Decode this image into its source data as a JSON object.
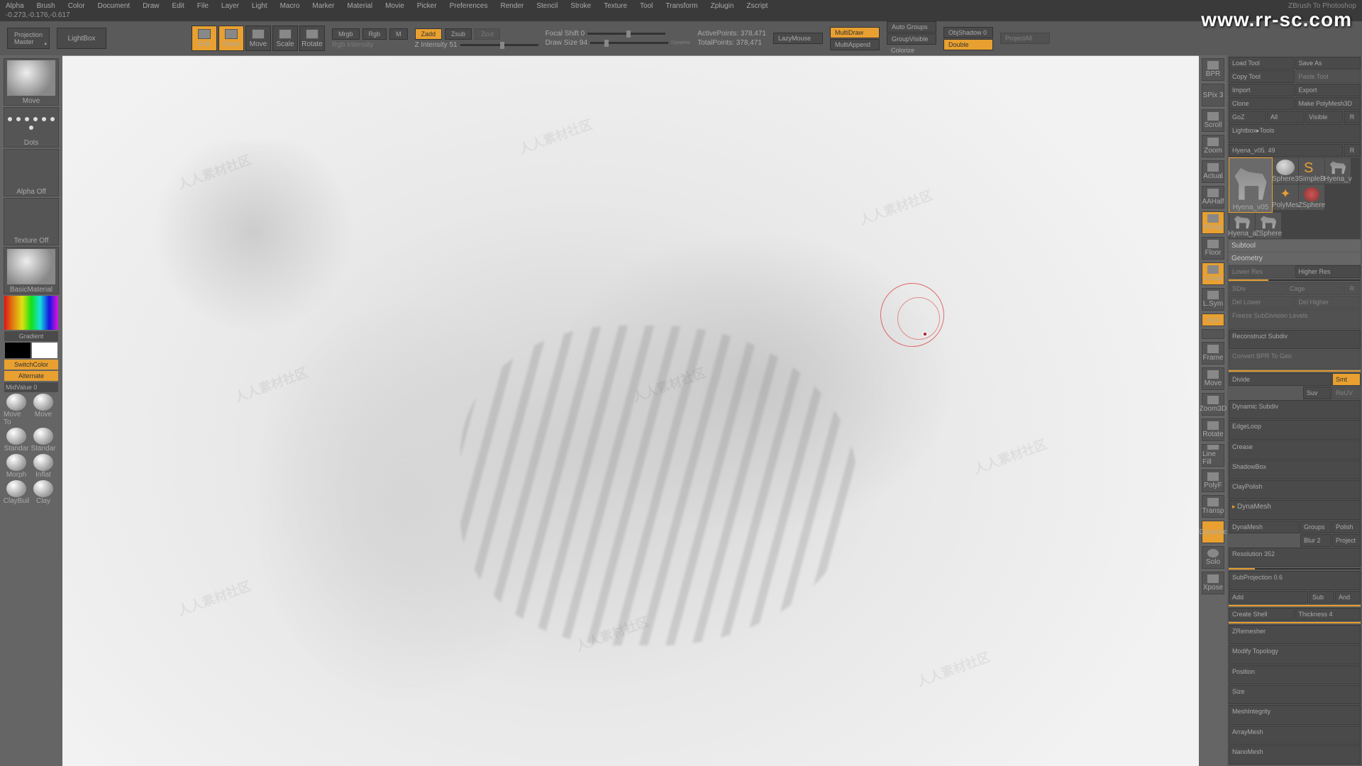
{
  "menubar": [
    "Alpha",
    "Brush",
    "Color",
    "Document",
    "Draw",
    "Edit",
    "File",
    "Layer",
    "Light",
    "Macro",
    "Marker",
    "Material",
    "Movie",
    "Picker",
    "Preferences",
    "Render",
    "Stencil",
    "Stroke",
    "Texture",
    "Tool",
    "Transform",
    "Zplugin",
    "Zscript"
  ],
  "app_title": "ZBrush To Photoshop",
  "coords": "-0.273,-0.176,-0.617",
  "url_watermark": "www.rr-sc.com",
  "toolbar": {
    "projection": "Projection\nMaster",
    "lightbox": "LightBox",
    "tools": [
      {
        "label": "Edit",
        "active": true
      },
      {
        "label": "Draw",
        "active": true
      },
      {
        "label": "Move",
        "active": false
      },
      {
        "label": "Scale",
        "active": false
      },
      {
        "label": "Rotate",
        "active": false
      }
    ],
    "rgb_intensity_label": "Rgb Intensity",
    "modes1": [
      "Mrgb",
      "Rgb",
      "M"
    ],
    "modes2": [
      {
        "l": "Zadd",
        "a": true
      },
      {
        "l": "Zsub",
        "a": false
      },
      {
        "l": "Zcut",
        "a": false
      }
    ],
    "z_intensity": "Z Intensity 51",
    "focal": "Focal Shift 0",
    "drawsize": "Draw Size 94",
    "dynamic": "Dynamic",
    "active_pts": "ActivePoints: 378,471",
    "total_pts": "TotalPoints: 378,471",
    "lazy": "LazyMouse",
    "col1": [
      {
        "l": "MultiDraw",
        "a": true
      },
      {
        "l": "MultiAppend",
        "a": false
      }
    ],
    "col2": [
      {
        "l": "Auto Groups",
        "a": false
      },
      {
        "l": "GroupVisible",
        "a": false
      },
      {
        "l": "Colorize",
        "a": false
      }
    ],
    "col3": [
      {
        "l": "ObjShadow 0",
        "a": false
      },
      {
        "l": "Double",
        "a": true
      },
      {
        "l": "",
        "a": false
      }
    ],
    "projectall": "ProjectAll"
  },
  "left": {
    "move": "Move",
    "dots": "Dots",
    "alpha_off": "Alpha Off",
    "texture_off": "Texture Off",
    "basic_mat": "BasicMaterial",
    "gradient": "Gradient",
    "switch": "SwitchColor",
    "alternate": "Alternate",
    "midvalue": "MidValue 0",
    "brushes": [
      "Move To",
      "Move",
      "Standar",
      "Standar",
      "Morph",
      "Inflat",
      "ClayBuil",
      "Clay"
    ]
  },
  "side_icons": [
    {
      "l": "BPR",
      "hl": false
    },
    {
      "l": "SPix 3",
      "hl": false
    },
    {
      "l": "Scroll",
      "hl": false
    },
    {
      "l": "Zoom",
      "hl": false
    },
    {
      "l": "Actual",
      "hl": false
    },
    {
      "l": "AAHalf",
      "hl": false
    },
    {
      "l": "Persp",
      "hl": true
    },
    {
      "l": "Floor",
      "hl": false
    },
    {
      "l": "Local",
      "hl": true
    },
    {
      "l": "L.Sym",
      "hl": false
    },
    {
      "l": "Xyz",
      "hl": true
    },
    {
      "l": "",
      "hl": false
    },
    {
      "l": "Frame",
      "hl": false
    },
    {
      "l": "Move",
      "hl": false
    },
    {
      "l": "Zoom3D",
      "hl": false
    },
    {
      "l": "Rotate",
      "hl": false
    },
    {
      "l": "Line Fill",
      "hl": false
    },
    {
      "l": "PolyF",
      "hl": false
    },
    {
      "l": "Transp",
      "hl": false
    },
    {
      "l": "Dynamic",
      "hl": true
    },
    {
      "l": "Solo",
      "hl": false
    },
    {
      "l": "Xpose",
      "hl": false
    }
  ],
  "right": {
    "row1": [
      "Load Tool",
      "Save As"
    ],
    "row2": [
      {
        "l": "Copy Tool"
      },
      {
        "l": "Paste Tool",
        "dim": true
      }
    ],
    "row3": [
      "Import",
      "Export"
    ],
    "row4": [
      "Clone",
      "Make PolyMesh3D"
    ],
    "row5": [
      {
        "l": "GoZ"
      },
      {
        "l": "All"
      },
      {
        "l": "Visible"
      },
      {
        "l": "R",
        "sm": true
      }
    ],
    "lightbox": "Lightbox▸Tools",
    "tool_name": "Hyena_v05. 49",
    "thumbs": [
      {
        "l": "Hyena_v05",
        "sel": true,
        "type": "animal"
      },
      {
        "l": "Sphere3",
        "type": "sphere"
      },
      {
        "l": "SimpleB",
        "type": "star"
      },
      {
        "l": "Hyena_v",
        "type": "animal"
      },
      {
        "l": "PolyMes",
        "type": "star2"
      },
      {
        "l": "ZSphere",
        "type": "sphere2"
      },
      {
        "l": "Hyena_a",
        "type": "animal"
      },
      {
        "l": "ZSphere",
        "type": "animal"
      }
    ],
    "subtool": "Subtool",
    "geometry": "Geometry",
    "geo_rows": [
      [
        {
          "l": "Lower Res",
          "dim": true
        },
        {
          "l": "Higher Res"
        }
      ],
      [
        {
          "l": "SDiv",
          "dim": true
        },
        {
          "l": "Cage",
          "dim": true
        },
        {
          "l": "R",
          "sm": true,
          "dim": true
        }
      ],
      [
        {
          "l": "Del Lower",
          "dim": true
        },
        {
          "l": "Del Higher",
          "dim": true
        }
      ],
      [
        {
          "l": "Freeze SubDivision Levels",
          "dim": true
        }
      ]
    ],
    "reconstruct": "Reconstruct Subdiv",
    "convert": "Convert BPR To Geo",
    "divide_row": [
      {
        "l": "Divide"
      },
      {
        "l": "Smt",
        "hl": true
      }
    ],
    "divide_row2": [
      {
        "l": "Suv"
      },
      {
        "l": "ReUV",
        "dim": true
      }
    ],
    "sections": [
      "Dynamic Subdiv",
      "EdgeLoop",
      "Crease",
      "ShadowBox",
      "ClayPolish"
    ],
    "dynamesh_hdr": "DynaMesh",
    "dyna_row1": [
      {
        "l": "DynaMesh"
      },
      {
        "l": "Groups"
      },
      {
        "l": "Polish"
      }
    ],
    "dyna_row2": [
      {
        "l": "Blur 2"
      },
      {
        "l": "Project"
      }
    ],
    "resolution": "Resolution 352",
    "subproj": "SubProjection 0.6",
    "dyna_row3": [
      {
        "l": "Add"
      },
      {
        "l": "Sub"
      },
      {
        "l": "And"
      }
    ],
    "dyna_row4": [
      {
        "l": "Create Shell"
      },
      {
        "l": "Thickness 4"
      }
    ],
    "sections2": [
      "ZRemesher",
      "Modify Topology",
      "Position",
      "Size",
      "MeshIntegrity",
      "ArrayMesh",
      "NanoMesh"
    ]
  }
}
